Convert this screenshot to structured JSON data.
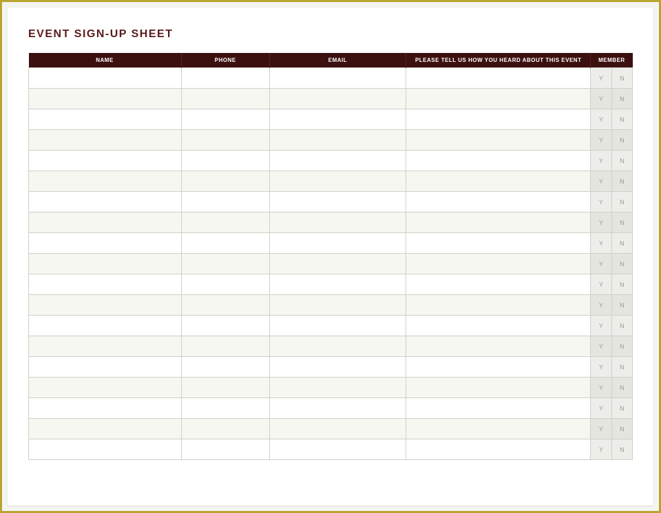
{
  "title": "EVENT SIGN-UP SHEET",
  "headers": {
    "name": "NAME",
    "phone": "PHONE",
    "email": "EMAIL",
    "heard": "PLEASE TELL US HOW YOU HEARD ABOUT THIS EVENT",
    "member": "MEMBER"
  },
  "member_options": {
    "yes": "Y",
    "no": "N"
  },
  "rows": [
    {
      "name": "",
      "phone": "",
      "email": "",
      "heard": ""
    },
    {
      "name": "",
      "phone": "",
      "email": "",
      "heard": ""
    },
    {
      "name": "",
      "phone": "",
      "email": "",
      "heard": ""
    },
    {
      "name": "",
      "phone": "",
      "email": "",
      "heard": ""
    },
    {
      "name": "",
      "phone": "",
      "email": "",
      "heard": ""
    },
    {
      "name": "",
      "phone": "",
      "email": "",
      "heard": ""
    },
    {
      "name": "",
      "phone": "",
      "email": "",
      "heard": ""
    },
    {
      "name": "",
      "phone": "",
      "email": "",
      "heard": ""
    },
    {
      "name": "",
      "phone": "",
      "email": "",
      "heard": ""
    },
    {
      "name": "",
      "phone": "",
      "email": "",
      "heard": ""
    },
    {
      "name": "",
      "phone": "",
      "email": "",
      "heard": ""
    },
    {
      "name": "",
      "phone": "",
      "email": "",
      "heard": ""
    },
    {
      "name": "",
      "phone": "",
      "email": "",
      "heard": ""
    },
    {
      "name": "",
      "phone": "",
      "email": "",
      "heard": ""
    },
    {
      "name": "",
      "phone": "",
      "email": "",
      "heard": ""
    },
    {
      "name": "",
      "phone": "",
      "email": "",
      "heard": ""
    },
    {
      "name": "",
      "phone": "",
      "email": "",
      "heard": ""
    },
    {
      "name": "",
      "phone": "",
      "email": "",
      "heard": ""
    },
    {
      "name": "",
      "phone": "",
      "email": "",
      "heard": ""
    }
  ]
}
